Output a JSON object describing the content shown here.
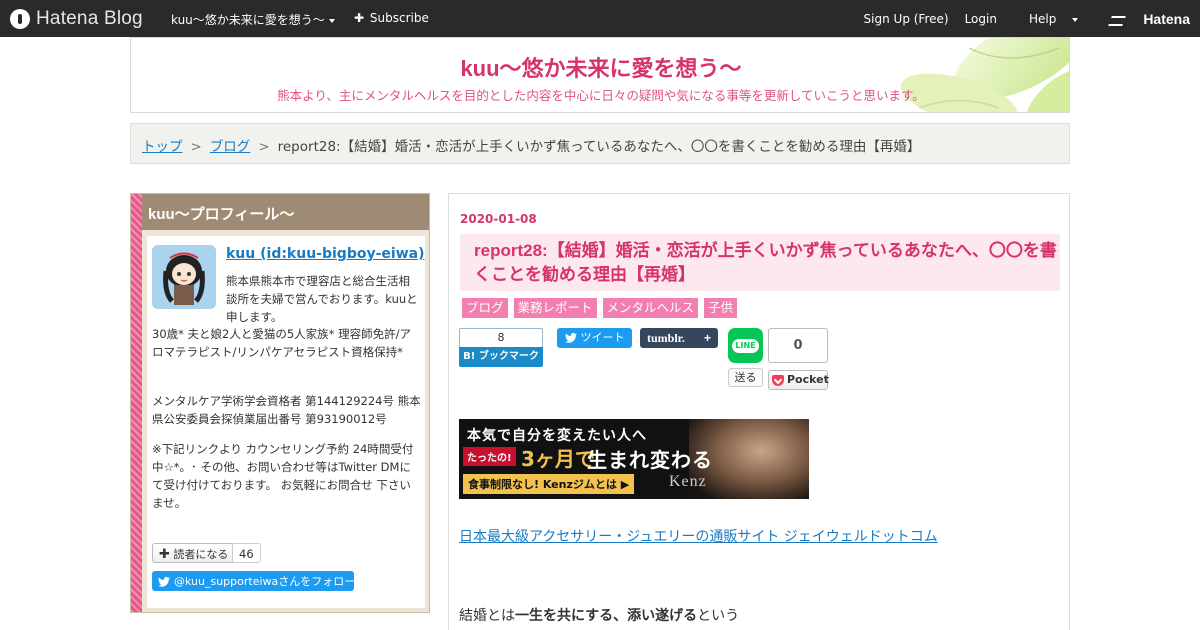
{
  "topbar": {
    "brand": "Hatena Blog",
    "blog_menu": "kuu～悠か未来に愛を想う～",
    "subscribe": "Subscribe",
    "signup": "Sign Up (Free)",
    "login": "Login",
    "help": "Help",
    "hatena": "Hatena"
  },
  "header": {
    "title": "kuu～悠か未来に愛を想う～",
    "description": "熊本より、主にメンタルヘルスを目的とした内容を中心に日々の疑問や気になる事等を更新していこうと思います。"
  },
  "breadcrumb": {
    "top": "トップ",
    "sep1": ">",
    "blog": "ブログ",
    "sep2": ">",
    "current": "report28:【結婚】婚活・恋活が上手くいかず焦っているあなたへ、〇〇を書くことを勧める理由【再婚】"
  },
  "sidebar": {
    "heading": "kuu～プロフィール～",
    "profile_name": "kuu (id:kuu-bigboy-eiwa)",
    "bio1": "熊本県熊本市で理容店と総合生活相談所を夫婦で営んでおります。kuuと申します。",
    "bio2": "30歳* 夫と娘2人と愛猫の5人家族* 理容師免許/アロマテラピスト/リンパケアセラピスト資格保持*",
    "bio3": "メンタルケア学術学会資格者 第144129224号 熊本県公安委員会探偵業届出番号 第93190012号",
    "bio4": "※下記リンクより カウンセリング予約 24時間受付中☆*。･ その他、お問い合わせ等はTwitter DMにて受け付けております。 お気軽にお問合せ 下さいませ。",
    "reader_button": "読者になる",
    "reader_count": "46",
    "twitter_follow": "@kuu_supporteiwaさんをフォロー"
  },
  "entry": {
    "date": "2020-01-08",
    "title": "report28:【結婚】婚活・恋活が上手くいかず焦っているあなたへ、〇〇を書くことを勧める理由【再婚】",
    "categories": [
      "ブログ",
      "業務レポート",
      "メンタルヘルス",
      "子供"
    ],
    "share": {
      "hatebu_count": "8",
      "hatebu_label": "B! ブックマーク",
      "tweet_label": "ツイート",
      "tumblr_label": "tumblr.",
      "tumblr_plus": "+",
      "line_label": "LINE",
      "send_label": "送る",
      "pocket_count": "0",
      "pocket_label": "Pocket"
    },
    "banner": {
      "line1": "本気で自分を変えたい人へ",
      "tag": "たったの!",
      "highlight": "3ヶ月で",
      "headline": "生まれ変わる",
      "cta": "食事制限なし! Kenzジムとは ▶",
      "brand": "Kenz"
    },
    "affiliate_link": "日本最大級アクセサリー・ジュエリーの通販サイト ジェイウェルドットコム",
    "body": {
      "pre": "結婚とは",
      "bold": "一生を共にする、添い遂げる",
      "post": "という"
    }
  },
  "colors": {
    "accent": "#d6336c",
    "link": "#1a7ac2",
    "category_bg": "#f27fb0",
    "topbar_bg": "#2a2a2a"
  }
}
